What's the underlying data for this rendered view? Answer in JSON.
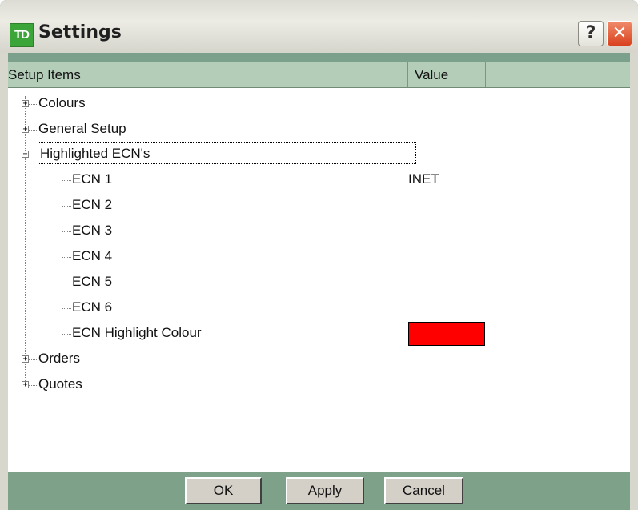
{
  "window": {
    "logo_text": "TD",
    "title": "Settings",
    "help_label": "?",
    "close_label": "✕"
  },
  "columns": [
    "Setup Items",
    "Value",
    ""
  ],
  "tree": {
    "colours": {
      "label": "Colours",
      "expander": "+"
    },
    "general": {
      "label": "General Setup",
      "expander": "+"
    },
    "highlighted": {
      "label": "Highlighted ECN's",
      "expander": "−",
      "children": [
        {
          "label": "ECN 1",
          "value": "INET"
        },
        {
          "label": "ECN 2",
          "value": ""
        },
        {
          "label": "ECN 3",
          "value": ""
        },
        {
          "label": "ECN 4",
          "value": ""
        },
        {
          "label": "ECN 5",
          "value": ""
        },
        {
          "label": "ECN 6",
          "value": ""
        },
        {
          "label": "ECN Highlight Colour",
          "value_color": "#ff0000"
        }
      ]
    },
    "orders": {
      "label": "Orders",
      "expander": "+"
    },
    "quotes": {
      "label": "Quotes",
      "expander": "+"
    }
  },
  "buttons": {
    "ok": "OK",
    "apply": "Apply",
    "cancel": "Cancel"
  }
}
